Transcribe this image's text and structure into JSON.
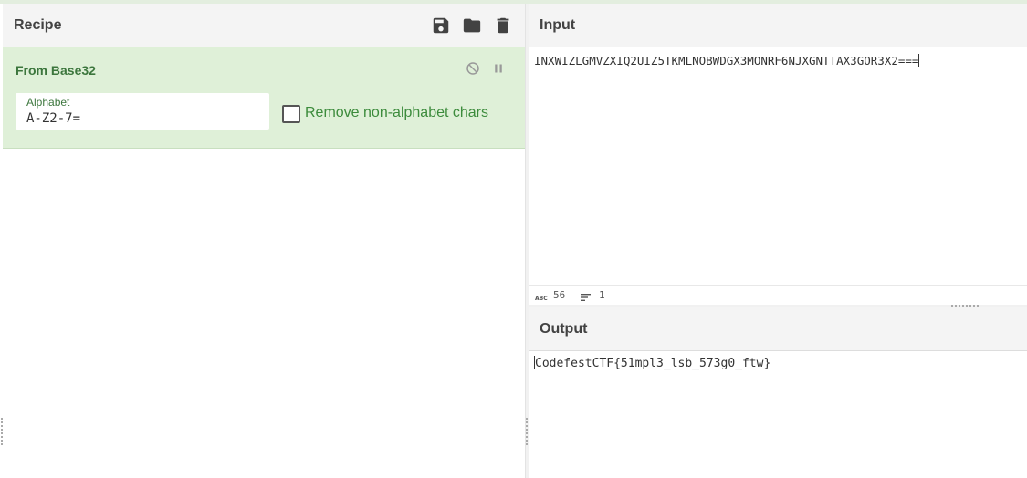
{
  "recipe": {
    "title": "Recipe",
    "header_icons": [
      "save-icon",
      "folder-icon",
      "trash-icon"
    ],
    "operation": {
      "name": "From Base32",
      "controls": [
        "disable-icon",
        "pause-icon"
      ],
      "alphabet_label": "Alphabet",
      "alphabet_value": "A-Z2-7=",
      "remove_non_alphabet_label": "Remove non-alphabet chars",
      "remove_non_alphabet_checked": false
    }
  },
  "input": {
    "title": "Input",
    "text": "INXWIZLGMVZXIQ2UIZ5TKMLNOBWDGX3MONRF6NJXGNTTAX3GOR3X2===",
    "length": "56",
    "lines": "1"
  },
  "output": {
    "title": "Output",
    "text": "CodefestCTF{51mpl3_lsb_573g0_ftw}"
  },
  "colors": {
    "operation_bg": "#dff0d8",
    "operation_text": "#3c763d",
    "header_bg": "#f4f4f4"
  }
}
